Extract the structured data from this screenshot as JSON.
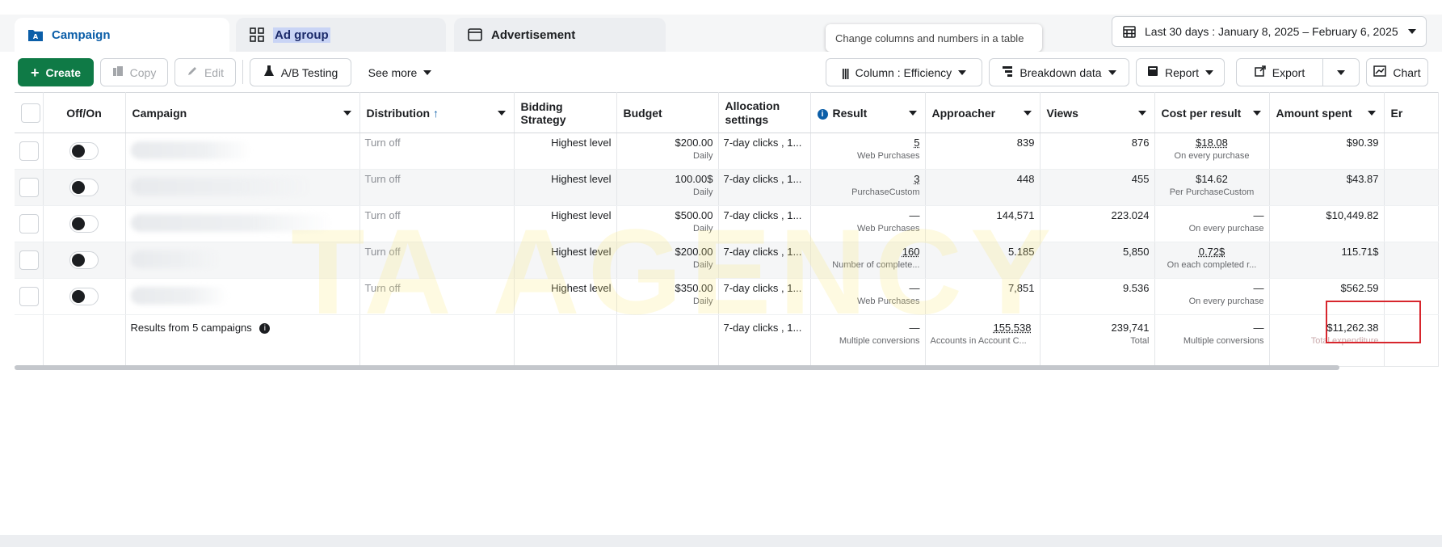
{
  "tabs": [
    {
      "label": "Campaign",
      "icon": "campaign-folder-icon"
    },
    {
      "label": "Ad group",
      "icon": "grid-icon"
    },
    {
      "label": "Advertisement",
      "icon": "ad-window-icon"
    }
  ],
  "tooltip": "Change columns and numbers in a table",
  "date_range": "Last 30 days : January 8, 2025 – February 6, 2025",
  "toolbar": {
    "create": "Create",
    "copy": "Copy",
    "edit": "Edit",
    "ab_testing": "A/B Testing",
    "see_more": "See more",
    "columns": "Column : Efficiency",
    "breakdown": "Breakdown data",
    "report": "Report",
    "export": "Export",
    "chart": "Chart"
  },
  "columns": {
    "off_on": "Off/On",
    "campaign": "Campaign",
    "distribution": "Distribution",
    "bidding": "Bidding Strategy",
    "budget": "Budget",
    "allocation": "Allocation settings",
    "result": "Result",
    "approacher": "Approacher",
    "views": "Views",
    "cost": "Cost per result",
    "amount": "Amount spent",
    "next": "Er"
  },
  "rows": [
    {
      "distribution": "Turn off",
      "bidding": "Highest level",
      "budget": "$200.00",
      "budget_sub": "Daily",
      "allocation": "7-day clicks , 1...",
      "result": "5",
      "result_sub": "Web Purchases",
      "approacher": "839",
      "views": "876",
      "cost": "$18.08",
      "cost_sub": "On every purchase",
      "amount": "$90.39"
    },
    {
      "distribution": "Turn off",
      "bidding": "Highest level",
      "budget": "100.00$",
      "budget_sub": "Daily",
      "allocation": "7-day clicks , 1...",
      "result": "3",
      "result_sub": "PurchaseCustom",
      "approacher": "448",
      "views": "455",
      "cost": "$14.62",
      "cost_sub": "Per PurchaseCustom",
      "amount": "$43.87"
    },
    {
      "distribution": "Turn off",
      "bidding": "Highest level",
      "budget": "$500.00",
      "budget_sub": "Daily",
      "allocation": "7-day clicks , 1...",
      "result": "—",
      "result_sub": "Web Purchases",
      "approacher": "144,571",
      "views": "223.024",
      "cost": "—",
      "cost_sub": "On every purchase",
      "amount": "$10,449.82"
    },
    {
      "distribution": "Turn off",
      "bidding": "Highest level",
      "budget": "$200.00",
      "budget_sub": "Daily",
      "allocation": "7-day clicks , 1...",
      "result": "160",
      "result_sub": "Number of complete...",
      "approacher": "5.185",
      "views": "5,850",
      "cost": "0.72$",
      "cost_sub": "On each completed r...",
      "amount": "115.71$"
    },
    {
      "distribution": "Turn off",
      "bidding": "Highest level",
      "budget": "$350.00",
      "budget_sub": "Daily",
      "allocation": "7-day clicks , 1...",
      "result": "—",
      "result_sub": "Web Purchases",
      "approacher": "7,851",
      "views": "9.536",
      "cost": "—",
      "cost_sub": "On every purchase",
      "amount": "$562.59"
    }
  ],
  "totals": {
    "label": "Results from 5 campaigns",
    "allocation": "7-day clicks , 1...",
    "result": "—",
    "result_sub": "Multiple conversions",
    "approacher": "155.538",
    "approacher_sub": "Accounts in Account C...",
    "views": "239,741",
    "views_sub": "Total",
    "cost": "—",
    "cost_sub": "Multiple conversions",
    "amount": "$11,262.38",
    "amount_sub": "Total expenditure"
  },
  "watermark": "TA AGENCY",
  "colors": {
    "primary_green": "#0f7a46",
    "accent_blue": "#0b5ea8",
    "highlight_red": "#d7262d"
  }
}
